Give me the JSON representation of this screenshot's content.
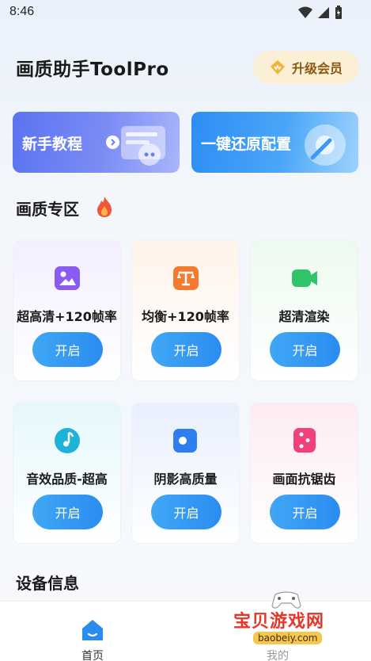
{
  "status_bar": {
    "time": "8:46"
  },
  "header": {
    "title": "画质助手ToolPro",
    "vip_label": "升级会员"
  },
  "banners": [
    {
      "label": "新手教程"
    },
    {
      "label": "一键还原配置"
    }
  ],
  "sections": {
    "quality": "画质专区",
    "device": "设备信息"
  },
  "cards": [
    {
      "label": "超高清+120帧率",
      "button": "开启"
    },
    {
      "label": "均衡+120帧率",
      "button": "开启"
    },
    {
      "label": "超清渲染",
      "button": "开启"
    },
    {
      "label": "音效品质-超高",
      "button": "开启"
    },
    {
      "label": "阴影高质量",
      "button": "开启"
    },
    {
      "label": "画面抗锯齿",
      "button": "开启"
    }
  ],
  "bottom_nav": {
    "home": "首页",
    "me": "我的"
  },
  "watermark": {
    "text": "宝贝游戏网",
    "url": "baobeiy.com"
  },
  "colors": {
    "accent": "#2b8cf0",
    "vip_bg": "#fbefd6",
    "vip_text": "#8a5a12"
  }
}
